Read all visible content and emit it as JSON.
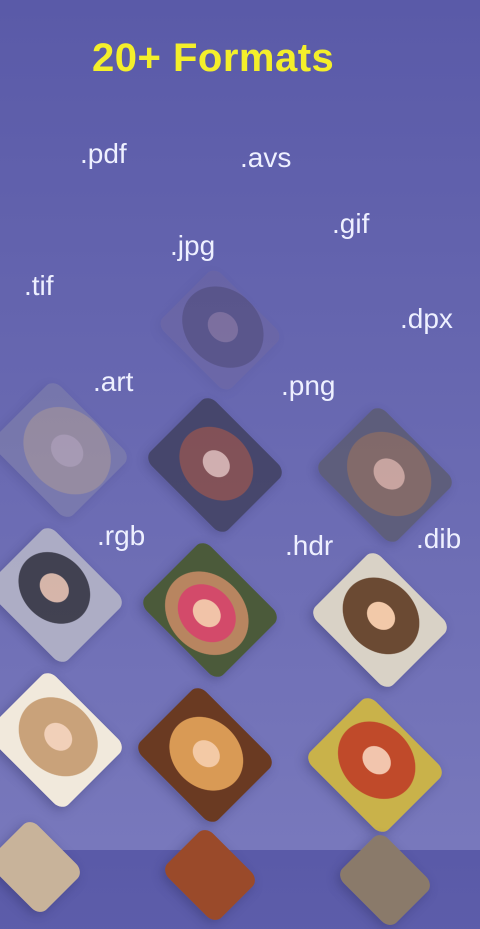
{
  "header": {
    "title": "20+ Formats"
  },
  "formats": [
    ".pdf",
    ".avs",
    ".gif",
    ".jpg",
    ".tif",
    ".dpx",
    ".art",
    ".png",
    ".rgb",
    ".hdr",
    ".dib"
  ],
  "thumbnails": [
    {
      "name": "photo-blonde-woman-faded",
      "accent": "#c9b38f"
    },
    {
      "name": "photo-red-hair-woman-flower",
      "accent": "#8b4a3a"
    },
    {
      "name": "photo-brunette-woman-portrait",
      "accent": "#8a6a52"
    },
    {
      "name": "photo-woman-sunglasses",
      "accent": "#3a3a40"
    },
    {
      "name": "photo-woman-flower-crown",
      "accent": "#d34a6a"
    },
    {
      "name": "photo-smiling-brunette",
      "accent": "#6b4a33"
    },
    {
      "name": "photo-woman-glasses",
      "accent": "#c9a27a"
    },
    {
      "name": "photo-blonde-woman-sunset",
      "accent": "#d99a55"
    },
    {
      "name": "photo-redhead-smiling",
      "accent": "#c04a2a"
    }
  ]
}
